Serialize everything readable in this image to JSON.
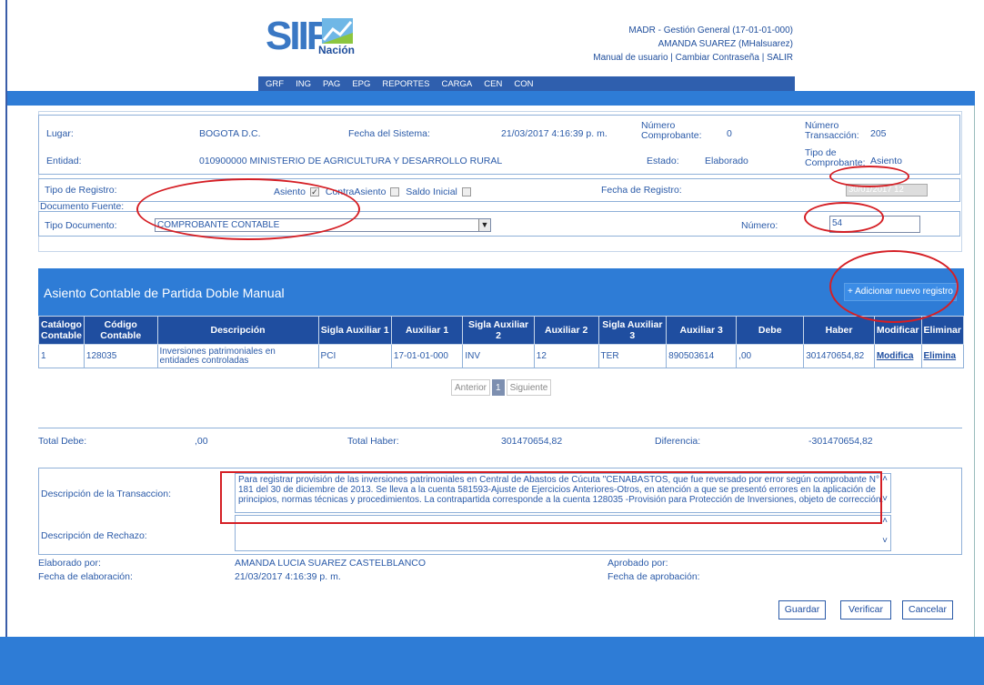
{
  "header": {
    "logo_text": "SIIF",
    "logo_sub": "Nación",
    "user_line1": "MADR - Gestión General (17-01-01-000)",
    "user_line2": "AMANDA SUAREZ (MHalsuarez)",
    "links": "Manual de usuario | Cambiar Contraseña | SALIR",
    "menu": [
      "GRF",
      "ING",
      "PAG",
      "EPG",
      "REPORTES",
      "CARGA",
      "CEN",
      "CON"
    ]
  },
  "info": {
    "lugar_label": "Lugar:",
    "lugar_value": "BOGOTA D.C.",
    "fecha_sistema_label": "Fecha del Sistema:",
    "fecha_sistema_value": "21/03/2017 4:16:39 p. m.",
    "num_comprobante_label": "Número Comprobante:",
    "num_comprobante_value": "0",
    "num_transaccion_label": "Número Transacción:",
    "num_transaccion_value": "205",
    "entidad_label": "Entidad:",
    "entidad_value": "010900000 MINISTERIO DE AGRICULTURA Y DESARROLLO RURAL",
    "estado_label": "Estado:",
    "estado_value": "Elaborado",
    "tipo_comprobante_label": "Tipo de Comprobante:",
    "tipo_comprobante_value": "Asiento"
  },
  "registro": {
    "tipo_registro_label": "Tipo de Registro:",
    "asiento_label": "Asiento",
    "contraasiento_label": "ContraAsiento",
    "saldo_inicial_label": "Saldo Inicial",
    "fecha_registro_label": "Fecha de Registro:",
    "fecha_registro_value": "30/01/2017 12"
  },
  "documento": {
    "fuente_label": "Documento Fuente:",
    "tipo_documento_label": "Tipo Documento:",
    "tipo_documento_value": "COMPROBANTE CONTABLE",
    "numero_label": "Número:",
    "numero_value": "54"
  },
  "panel": {
    "title": "Asiento Contable de Partida Doble Manual",
    "add_button": "+ Adicionar nuevo registro"
  },
  "table": {
    "headers": [
      "Catálogo Contable",
      "Código Contable",
      "Descripción",
      "Sigla Auxiliar 1",
      "Auxiliar 1",
      "Sigla Auxiliar 2",
      "Auxiliar 2",
      "Sigla Auxiliar 3",
      "Auxiliar 3",
      "Debe",
      "Haber",
      "Modificar",
      "Eliminar"
    ],
    "rows": [
      {
        "catalogo": "1",
        "codigo": "128035",
        "descripcion": "Inversiones patrimoniales en entidades controladas",
        "sigla1": "PCI",
        "aux1": "17-01-01-000",
        "sigla2": "INV",
        "aux2": "12",
        "sigla3": "TER",
        "aux3": "890503614",
        "debe": ",00",
        "haber": "301470654,82",
        "modificar": "Modifica",
        "eliminar": "Elimina"
      }
    ]
  },
  "pager": {
    "prev": "Anterior",
    "current": "1",
    "next": "Siguiente"
  },
  "totals": {
    "debe_label": "Total Debe:",
    "debe_value": ",00",
    "haber_label": "Total Haber:",
    "haber_value": "301470654,82",
    "diferencia_label": "Diferencia:",
    "diferencia_value": "-301470654,82"
  },
  "description": {
    "transaccion_label": "Descripción de la Transaccion:",
    "transaccion_value": "Para registrar provisión de las inversiones patrimoniales en  Central de Abastos de Cúcuta \"CENABASTOS, que fue reversado por error según comprobante N° 181 del 30 de diciembre de 2013. Se lleva a la cuenta 581593-Ajuste de Ejercicios Anteriores-Otros, en atención a que se presentó errores en la aplicación de principios, normas técnicas y procedimientos. La contrapartida corresponde a la cuenta 128035 -Provisión para Protección de Inversiones, objeto de corrección.",
    "rechazo_label": "Descripción de Rechazo:",
    "rechazo_value": "",
    "elaborado_label": "Elaborado por:",
    "elaborado_value": "AMANDA LUCIA SUAREZ CASTELBLANCO",
    "aprobado_label": "Aprobado por:",
    "aprobado_value": "",
    "fecha_elab_label": "Fecha de elaboración:",
    "fecha_elab_value": "21/03/2017 4:16:39 p. m.",
    "fecha_aprob_label": "Fecha de aprobación:",
    "fecha_aprob_value": ""
  },
  "buttons": {
    "guardar": "Guardar",
    "verificar": "Verificar",
    "cancelar": "Cancelar"
  },
  "colors": {
    "accent_blue": "#2e7cd6",
    "header_dark": "#1f4ea0",
    "annotation_red": "#d51f25"
  }
}
